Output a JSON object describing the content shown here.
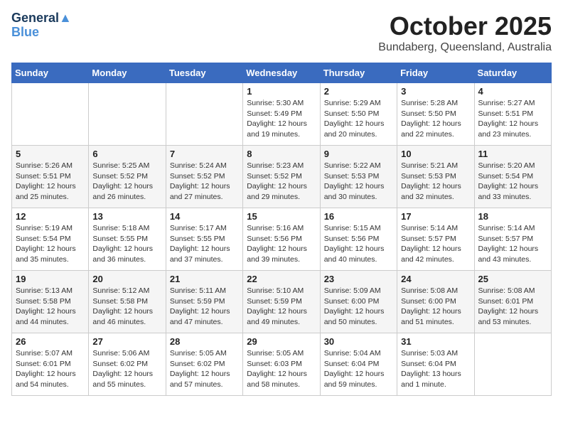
{
  "header": {
    "logo_line1": "General",
    "logo_line2": "Blue",
    "month": "October 2025",
    "location": "Bundaberg, Queensland, Australia"
  },
  "weekdays": [
    "Sunday",
    "Monday",
    "Tuesday",
    "Wednesday",
    "Thursday",
    "Friday",
    "Saturday"
  ],
  "weeks": [
    [
      {
        "day": "",
        "sunrise": "",
        "sunset": "",
        "daylight": ""
      },
      {
        "day": "",
        "sunrise": "",
        "sunset": "",
        "daylight": ""
      },
      {
        "day": "",
        "sunrise": "",
        "sunset": "",
        "daylight": ""
      },
      {
        "day": "1",
        "sunrise": "Sunrise: 5:30 AM",
        "sunset": "Sunset: 5:49 PM",
        "daylight": "Daylight: 12 hours and 19 minutes."
      },
      {
        "day": "2",
        "sunrise": "Sunrise: 5:29 AM",
        "sunset": "Sunset: 5:50 PM",
        "daylight": "Daylight: 12 hours and 20 minutes."
      },
      {
        "day": "3",
        "sunrise": "Sunrise: 5:28 AM",
        "sunset": "Sunset: 5:50 PM",
        "daylight": "Daylight: 12 hours and 22 minutes."
      },
      {
        "day": "4",
        "sunrise": "Sunrise: 5:27 AM",
        "sunset": "Sunset: 5:51 PM",
        "daylight": "Daylight: 12 hours and 23 minutes."
      }
    ],
    [
      {
        "day": "5",
        "sunrise": "Sunrise: 5:26 AM",
        "sunset": "Sunset: 5:51 PM",
        "daylight": "Daylight: 12 hours and 25 minutes."
      },
      {
        "day": "6",
        "sunrise": "Sunrise: 5:25 AM",
        "sunset": "Sunset: 5:52 PM",
        "daylight": "Daylight: 12 hours and 26 minutes."
      },
      {
        "day": "7",
        "sunrise": "Sunrise: 5:24 AM",
        "sunset": "Sunset: 5:52 PM",
        "daylight": "Daylight: 12 hours and 27 minutes."
      },
      {
        "day": "8",
        "sunrise": "Sunrise: 5:23 AM",
        "sunset": "Sunset: 5:52 PM",
        "daylight": "Daylight: 12 hours and 29 minutes."
      },
      {
        "day": "9",
        "sunrise": "Sunrise: 5:22 AM",
        "sunset": "Sunset: 5:53 PM",
        "daylight": "Daylight: 12 hours and 30 minutes."
      },
      {
        "day": "10",
        "sunrise": "Sunrise: 5:21 AM",
        "sunset": "Sunset: 5:53 PM",
        "daylight": "Daylight: 12 hours and 32 minutes."
      },
      {
        "day": "11",
        "sunrise": "Sunrise: 5:20 AM",
        "sunset": "Sunset: 5:54 PM",
        "daylight": "Daylight: 12 hours and 33 minutes."
      }
    ],
    [
      {
        "day": "12",
        "sunrise": "Sunrise: 5:19 AM",
        "sunset": "Sunset: 5:54 PM",
        "daylight": "Daylight: 12 hours and 35 minutes."
      },
      {
        "day": "13",
        "sunrise": "Sunrise: 5:18 AM",
        "sunset": "Sunset: 5:55 PM",
        "daylight": "Daylight: 12 hours and 36 minutes."
      },
      {
        "day": "14",
        "sunrise": "Sunrise: 5:17 AM",
        "sunset": "Sunset: 5:55 PM",
        "daylight": "Daylight: 12 hours and 37 minutes."
      },
      {
        "day": "15",
        "sunrise": "Sunrise: 5:16 AM",
        "sunset": "Sunset: 5:56 PM",
        "daylight": "Daylight: 12 hours and 39 minutes."
      },
      {
        "day": "16",
        "sunrise": "Sunrise: 5:15 AM",
        "sunset": "Sunset: 5:56 PM",
        "daylight": "Daylight: 12 hours and 40 minutes."
      },
      {
        "day": "17",
        "sunrise": "Sunrise: 5:14 AM",
        "sunset": "Sunset: 5:57 PM",
        "daylight": "Daylight: 12 hours and 42 minutes."
      },
      {
        "day": "18",
        "sunrise": "Sunrise: 5:14 AM",
        "sunset": "Sunset: 5:57 PM",
        "daylight": "Daylight: 12 hours and 43 minutes."
      }
    ],
    [
      {
        "day": "19",
        "sunrise": "Sunrise: 5:13 AM",
        "sunset": "Sunset: 5:58 PM",
        "daylight": "Daylight: 12 hours and 44 minutes."
      },
      {
        "day": "20",
        "sunrise": "Sunrise: 5:12 AM",
        "sunset": "Sunset: 5:58 PM",
        "daylight": "Daylight: 12 hours and 46 minutes."
      },
      {
        "day": "21",
        "sunrise": "Sunrise: 5:11 AM",
        "sunset": "Sunset: 5:59 PM",
        "daylight": "Daylight: 12 hours and 47 minutes."
      },
      {
        "day": "22",
        "sunrise": "Sunrise: 5:10 AM",
        "sunset": "Sunset: 5:59 PM",
        "daylight": "Daylight: 12 hours and 49 minutes."
      },
      {
        "day": "23",
        "sunrise": "Sunrise: 5:09 AM",
        "sunset": "Sunset: 6:00 PM",
        "daylight": "Daylight: 12 hours and 50 minutes."
      },
      {
        "day": "24",
        "sunrise": "Sunrise: 5:08 AM",
        "sunset": "Sunset: 6:00 PM",
        "daylight": "Daylight: 12 hours and 51 minutes."
      },
      {
        "day": "25",
        "sunrise": "Sunrise: 5:08 AM",
        "sunset": "Sunset: 6:01 PM",
        "daylight": "Daylight: 12 hours and 53 minutes."
      }
    ],
    [
      {
        "day": "26",
        "sunrise": "Sunrise: 5:07 AM",
        "sunset": "Sunset: 6:01 PM",
        "daylight": "Daylight: 12 hours and 54 minutes."
      },
      {
        "day": "27",
        "sunrise": "Sunrise: 5:06 AM",
        "sunset": "Sunset: 6:02 PM",
        "daylight": "Daylight: 12 hours and 55 minutes."
      },
      {
        "day": "28",
        "sunrise": "Sunrise: 5:05 AM",
        "sunset": "Sunset: 6:02 PM",
        "daylight": "Daylight: 12 hours and 57 minutes."
      },
      {
        "day": "29",
        "sunrise": "Sunrise: 5:05 AM",
        "sunset": "Sunset: 6:03 PM",
        "daylight": "Daylight: 12 hours and 58 minutes."
      },
      {
        "day": "30",
        "sunrise": "Sunrise: 5:04 AM",
        "sunset": "Sunset: 6:04 PM",
        "daylight": "Daylight: 12 hours and 59 minutes."
      },
      {
        "day": "31",
        "sunrise": "Sunrise: 5:03 AM",
        "sunset": "Sunset: 6:04 PM",
        "daylight": "Daylight: 13 hours and 1 minute."
      },
      {
        "day": "",
        "sunrise": "",
        "sunset": "",
        "daylight": ""
      }
    ]
  ]
}
